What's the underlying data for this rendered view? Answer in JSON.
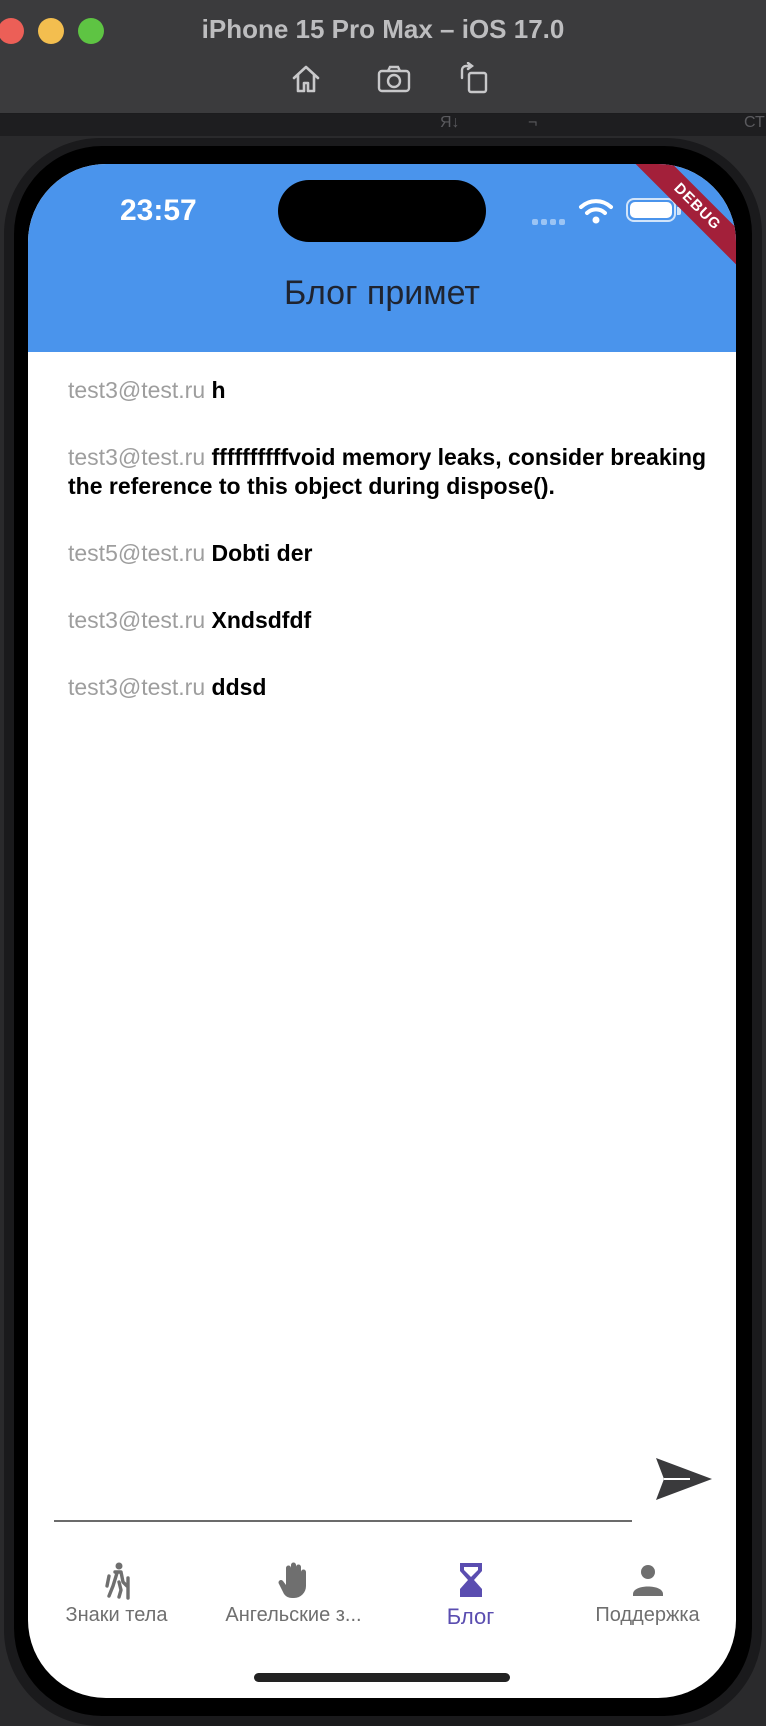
{
  "window": {
    "title": "iPhone 15 Pro Max – iOS 17.0",
    "toolbar": [
      "home-icon",
      "screenshot-icon",
      "rotate-icon"
    ]
  },
  "ide_strip": {
    "items": [
      "Я↓",
      "¬",
      "СТ"
    ]
  },
  "status_bar": {
    "time": "23:57"
  },
  "debug_banner": "DEBUG",
  "app_bar": {
    "title": "Блог примет"
  },
  "posts": [
    {
      "author": "test3@test.ru",
      "text": "h"
    },
    {
      "author": "test3@test.ru",
      "text": "ffffffffffvoid memory leaks, consider breaking the reference to this object during dispose()."
    },
    {
      "author": "test5@test.ru",
      "text": "Dobti der"
    },
    {
      "author": "test3@test.ru",
      "text": "Xndsdfdf"
    },
    {
      "author": "test3@test.ru",
      "text": "ddsd"
    }
  ],
  "composer": {
    "value": "",
    "placeholder": "",
    "send_icon": "send-icon"
  },
  "nav": {
    "items": [
      {
        "label": "Знаки тела",
        "icon": "hiking-icon",
        "active": false
      },
      {
        "label": "Ангельские з...",
        "icon": "hand-icon",
        "active": false
      },
      {
        "label": "Блог",
        "icon": "hourglass-icon",
        "active": true
      },
      {
        "label": "Поддержка",
        "icon": "person-icon",
        "active": false
      }
    ],
    "active_color": "#5a4db0",
    "inactive_color": "#6f6f6f"
  },
  "colors": {
    "app_bar": "#4a94ec",
    "author": "#9e9e9e",
    "debug": "#a3203a"
  }
}
